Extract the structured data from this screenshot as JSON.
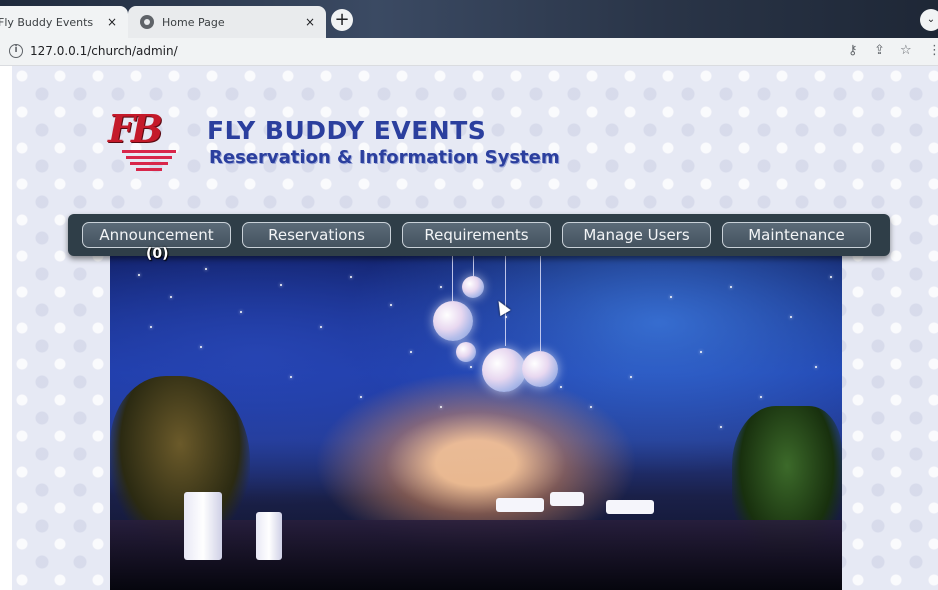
{
  "browser": {
    "tabs": [
      {
        "title": "Fly Buddy Events",
        "close": "×"
      },
      {
        "title": "Home Page",
        "close": "×"
      }
    ],
    "new_tab": "+",
    "window_menu": "⌄",
    "url": "127.0.0.1/church/admin/",
    "icons": [
      "info-icon",
      "key-icon",
      "share-icon",
      "star-icon",
      "kebab-menu-icon"
    ]
  },
  "site": {
    "logo_text": "FB",
    "title": "FLY BUDDY EVENTS",
    "subtitle": "Reservation & Information System"
  },
  "nav": {
    "items": [
      {
        "label": "Announcement"
      },
      {
        "label": "Reservations"
      },
      {
        "label": "Requirements"
      },
      {
        "label": "Manage Users"
      },
      {
        "label": "Maintenance"
      }
    ],
    "announcement_count": "(0)"
  },
  "colors": {
    "title_blue": "#2b3f9e",
    "logo_red": "#c41a2a",
    "nav_bg": "#2f3e48"
  }
}
